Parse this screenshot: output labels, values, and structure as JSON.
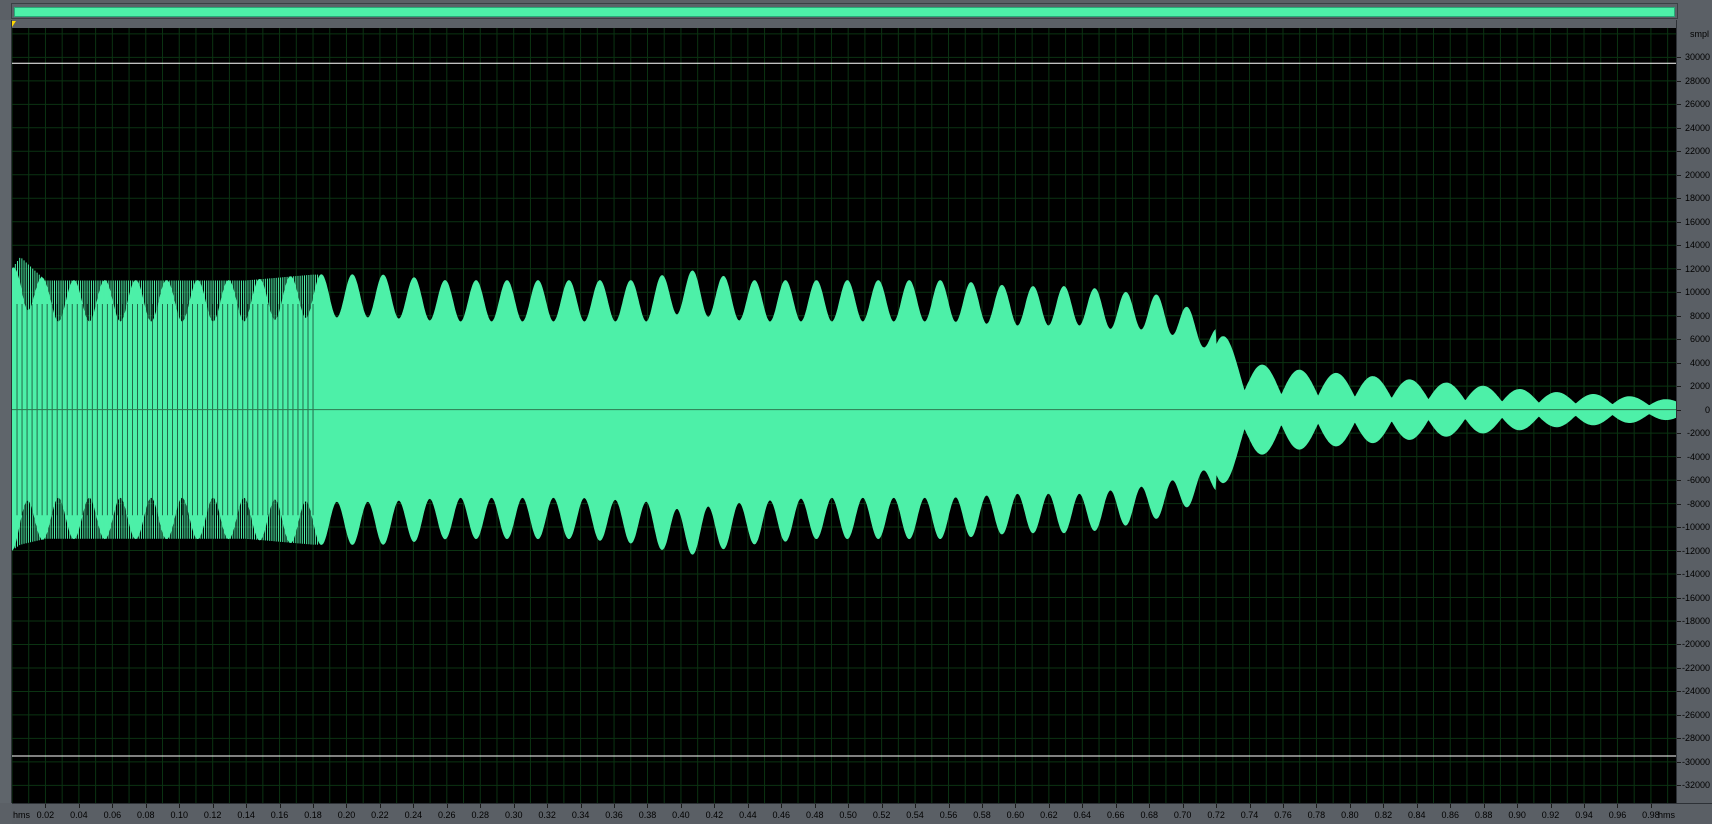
{
  "overview": {
    "state": "full-file-visible"
  },
  "colors": {
    "waveform": "#4df0a8",
    "background": "#000000",
    "grid": "#0b3312",
    "limit_lines": "#ffffff",
    "ruler": "#5a5f65",
    "cursor": "#ffd800"
  },
  "y_ruler": {
    "unit": "smpl",
    "ticks": [
      "30000",
      "28000",
      "26000",
      "24000",
      "22000",
      "20000",
      "18000",
      "16000",
      "14000",
      "12000",
      "10000",
      "8000",
      "6000",
      "4000",
      "2000",
      "0",
      "-2000",
      "-4000",
      "-6000",
      "-8000",
      "-10000",
      "-12000",
      "-14000",
      "-16000",
      "-18000",
      "-20000",
      "-22000",
      "-24000",
      "-26000",
      "-28000",
      "-30000",
      "-32000"
    ]
  },
  "x_ruler": {
    "unit_left": "hms",
    "unit_right": "hms",
    "ticks": [
      "0.02",
      "0.04",
      "0.06",
      "0.08",
      "0.10",
      "0.12",
      "0.14",
      "0.16",
      "0.18",
      "0.20",
      "0.22",
      "0.24",
      "0.26",
      "0.28",
      "0.30",
      "0.32",
      "0.34",
      "0.36",
      "0.38",
      "0.40",
      "0.42",
      "0.44",
      "0.46",
      "0.48",
      "0.50",
      "0.52",
      "0.54",
      "0.56",
      "0.58",
      "0.60",
      "0.62",
      "0.64",
      "0.66",
      "0.68",
      "0.70",
      "0.72",
      "0.74",
      "0.76",
      "0.78",
      "0.80",
      "0.82",
      "0.84",
      "0.86",
      "0.88",
      "0.90",
      "0.92",
      "0.94",
      "0.96",
      "0.98"
    ]
  },
  "chart_data": {
    "type": "area",
    "x_unit": "hms",
    "y_unit": "smpl",
    "xlim": [
      0,
      0.995
    ],
    "ylim": [
      -33500,
      32500
    ],
    "limit_lines": [
      29500,
      -29500
    ],
    "grid": true,
    "envelope": {
      "x": [
        0.0,
        0.005,
        0.02,
        0.06,
        0.1,
        0.14,
        0.18,
        0.22,
        0.26,
        0.3,
        0.34,
        0.38,
        0.4,
        0.44,
        0.48,
        0.52,
        0.56,
        0.6,
        0.64,
        0.66,
        0.68,
        0.7,
        0.72,
        0.74,
        0.76,
        0.8,
        0.84,
        0.88,
        0.92,
        0.96,
        0.995
      ],
      "upper": [
        12000,
        13000,
        11000,
        11000,
        11000,
        11000,
        11500,
        11500,
        11000,
        11000,
        11000,
        11000,
        12000,
        11000,
        11000,
        11000,
        11000,
        10500,
        10500,
        10000,
        10000,
        9000,
        7000,
        4000,
        3500,
        3000,
        2500,
        2000,
        1500,
        1200,
        800
      ],
      "lower": [
        -12000,
        -11500,
        -11000,
        -11000,
        -11000,
        -11000,
        -11500,
        -11500,
        -11000,
        -11000,
        -11000,
        -11500,
        -12500,
        -11500,
        -11000,
        -11000,
        -11000,
        -10500,
        -10500,
        -10000,
        -9500,
        -8500,
        -7000,
        -4000,
        -3500,
        -3000,
        -2500,
        -2000,
        -1500,
        -1200,
        -800
      ]
    }
  }
}
